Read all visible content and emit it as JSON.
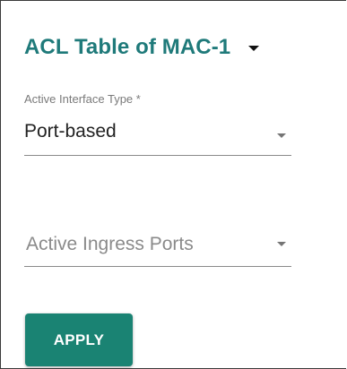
{
  "header": {
    "title": "ACL Table of MAC-1",
    "caret_icon": "caret-down-icon"
  },
  "form": {
    "interface_type": {
      "label": "Active Interface Type *",
      "value": "Port-based",
      "icon": "dropdown-arrow-icon"
    },
    "ingress_ports": {
      "placeholder": "Active Ingress Ports",
      "icon": "dropdown-arrow-icon"
    }
  },
  "actions": {
    "apply_label": "APPLY"
  },
  "colors": {
    "title": "#1f7a7a",
    "button_bg": "#1a8373",
    "button_text": "#ffffff"
  }
}
